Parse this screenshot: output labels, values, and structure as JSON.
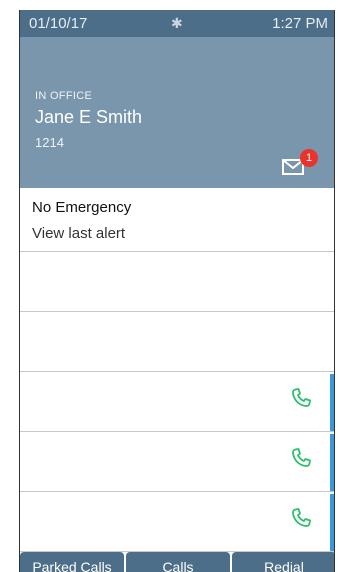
{
  "statusbar": {
    "date": "01/10/17",
    "time": "1:27 PM",
    "bluetooth_icon": "bluetooth-icon"
  },
  "header": {
    "presence": "IN OFFICE",
    "name": "Jane E Smith",
    "extension": "1214",
    "mail_icon": "envelope-icon",
    "unread_count": "1"
  },
  "alert": {
    "title": "No Emergency",
    "subtitle": "View last alert"
  },
  "lines": [
    {
      "has_phone_icon": false
    },
    {
      "has_phone_icon": false
    },
    {
      "has_phone_icon": true
    },
    {
      "has_phone_icon": true
    },
    {
      "has_phone_icon": true
    }
  ],
  "softkeys": {
    "parked_calls": "Parked Calls",
    "calls": "Calls",
    "redial": "Redial"
  },
  "colors": {
    "statusbar": "#4c6e89",
    "header": "#7a96ad",
    "badge": "#e9332b",
    "phone_icon": "#2dbd6e",
    "accent": "#3a9ad9"
  }
}
